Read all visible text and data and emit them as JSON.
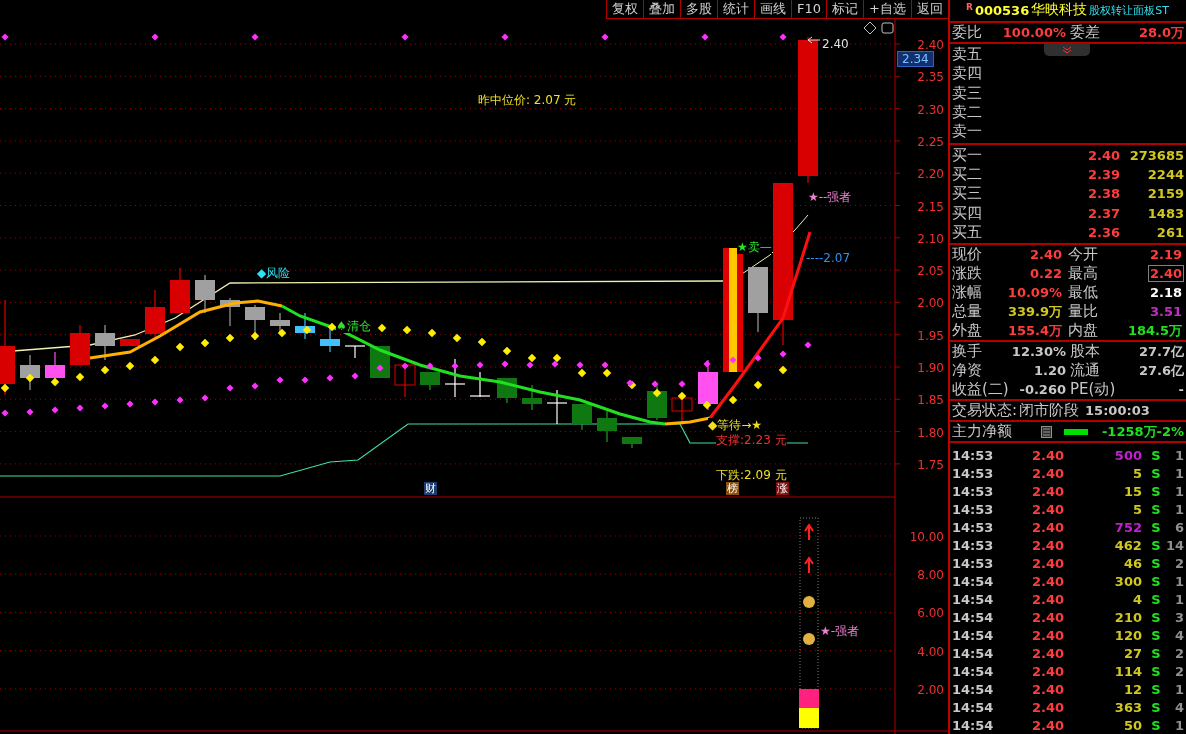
{
  "toolbar": [
    "复权",
    "叠加",
    "多股",
    "统计",
    "画线",
    "F10",
    "标记",
    "+自选",
    "返回"
  ],
  "chart": {
    "price_ticks": [
      "2.40",
      "2.35",
      "2.30",
      "2.25",
      "2.20",
      "2.15",
      "2.10",
      "2.05",
      "2.00",
      "1.95",
      "1.90",
      "1.85",
      "1.80",
      "1.75"
    ],
    "current_price_tag": "2.34",
    "labels": [
      {
        "text": "2.40",
        "color": "#e0e0e0"
      },
      {
        "text": "昨中位价: 2.07 元",
        "color": "#f0e020"
      },
      {
        "text": "★--强者",
        "color": "#f080d0"
      },
      {
        "text": "★卖—",
        "color": "#30e030"
      },
      {
        "text": "----2.07",
        "color": "#3090f0"
      },
      {
        "text": "◆风险",
        "color": "#30e0f0"
      },
      {
        "text": "♠清仓",
        "color": "#30e030"
      },
      {
        "text": "◆等待→★",
        "color": "#f0e020"
      },
      {
        "text": "支撑:2.23 元",
        "color": "#f03030"
      },
      {
        "text": "下跌:2.09 元",
        "color": "#f0e020"
      }
    ],
    "badges": [
      {
        "text": "财",
        "color": "#1c3c70"
      },
      {
        "text": "榜",
        "color": "#8a5010"
      },
      {
        "text": "涨",
        "color": "#801010"
      }
    ]
  },
  "indicator": {
    "ticks": [
      "10.00",
      "8.00",
      "6.00",
      "4.00",
      "2.00"
    ],
    "label": "★-强者"
  },
  "quote": {
    "badge": "R",
    "code": "000536",
    "name": "华映科技",
    "tag": "股权转让面板ST",
    "ratio": {
      "label": "委比",
      "value": "100.00%",
      "label2": "委差",
      "value2": "28.0万"
    },
    "sell": [
      {
        "label": "卖五"
      },
      {
        "label": "卖四"
      },
      {
        "label": "卖三"
      },
      {
        "label": "卖二"
      },
      {
        "label": "卖一"
      }
    ],
    "buy": [
      {
        "label": "买一",
        "price": "2.40",
        "volume": "273685"
      },
      {
        "label": "买二",
        "price": "2.39",
        "volume": "2244"
      },
      {
        "label": "买三",
        "price": "2.38",
        "volume": "2159"
      },
      {
        "label": "买四",
        "price": "2.37",
        "volume": "1483"
      },
      {
        "label": "买五",
        "price": "2.36",
        "volume": "261"
      }
    ],
    "stats": [
      {
        "label": "现价",
        "value": "2.40",
        "color": "#ff3c3c",
        "highlighted": false
      },
      {
        "label": "今开",
        "value": "2.19",
        "color": "#ff3c3c",
        "highlighted": false
      },
      {
        "label": "涨跌",
        "value": "0.22",
        "color": "#ff3c3c",
        "highlighted": false
      },
      {
        "label": "最高",
        "value": "2.40",
        "color": "#ff3c3c",
        "highlighted": true
      },
      {
        "label": "涨幅",
        "value": "10.09%",
        "color": "#ff3c3c",
        "highlighted": false
      },
      {
        "label": "最低",
        "value": "2.18",
        "color": "#ffffff",
        "highlighted": false
      },
      {
        "label": "总量",
        "value": "339.9万",
        "color": "#d0c820",
        "highlighted": false
      },
      {
        "label": "量比",
        "value": "3.51",
        "color": "#c030c0",
        "highlighted": false
      },
      {
        "label": "外盘",
        "value": "155.4万",
        "color": "#ff3c3c",
        "highlighted": false
      },
      {
        "label": "内盘",
        "value": "184.5万",
        "color": "#20e020",
        "highlighted": false
      }
    ],
    "fundamentals": [
      {
        "label": "换手",
        "value": "12.30%",
        "label2": "股本",
        "value2": "27.7亿"
      },
      {
        "label": "净资",
        "value": "1.20",
        "label2": "流通",
        "value2": "27.6亿"
      },
      {
        "label": "收益(二)",
        "value": "-0.260",
        "label2": "PE(动)",
        "value2": "-"
      }
    ],
    "status": {
      "label": "交易状态:",
      "value": "闭市阶段",
      "time": "15:00:03"
    },
    "main_flow": {
      "label": "主力净额",
      "value": "-1258万",
      "percent": "-2%"
    },
    "trades": [
      {
        "time": "14:53",
        "price": "2.40",
        "volume": "500",
        "color": "#c020d0",
        "side": "S",
        "count": "1"
      },
      {
        "time": "14:53",
        "price": "2.40",
        "volume": "5",
        "color": "#d0c820",
        "side": "S",
        "count": "1"
      },
      {
        "time": "14:53",
        "price": "2.40",
        "volume": "15",
        "color": "#d0c820",
        "side": "S",
        "count": "1"
      },
      {
        "time": "14:53",
        "price": "2.40",
        "volume": "5",
        "color": "#d0c820",
        "side": "S",
        "count": "1"
      },
      {
        "time": "14:53",
        "price": "2.40",
        "volume": "752",
        "color": "#c020d0",
        "side": "S",
        "count": "6"
      },
      {
        "time": "14:53",
        "price": "2.40",
        "volume": "462",
        "color": "#d0c820",
        "side": "S",
        "count": "14"
      },
      {
        "time": "14:53",
        "price": "2.40",
        "volume": "46",
        "color": "#d0c820",
        "side": "S",
        "count": "2"
      },
      {
        "time": "14:54",
        "price": "2.40",
        "volume": "300",
        "color": "#d0c820",
        "side": "S",
        "count": "1"
      },
      {
        "time": "14:54",
        "price": "2.40",
        "volume": "4",
        "color": "#d0c820",
        "side": "S",
        "count": "1"
      },
      {
        "time": "14:54",
        "price": "2.40",
        "volume": "210",
        "color": "#d0c820",
        "side": "S",
        "count": "3"
      },
      {
        "time": "14:54",
        "price": "2.40",
        "volume": "120",
        "color": "#d0c820",
        "side": "S",
        "count": "4"
      },
      {
        "time": "14:54",
        "price": "2.40",
        "volume": "27",
        "color": "#d0c820",
        "side": "S",
        "count": "2"
      },
      {
        "time": "14:54",
        "price": "2.40",
        "volume": "114",
        "color": "#d0c820",
        "side": "S",
        "count": "2"
      },
      {
        "time": "14:54",
        "price": "2.40",
        "volume": "12",
        "color": "#d0c820",
        "side": "S",
        "count": "1"
      },
      {
        "time": "14:54",
        "price": "2.40",
        "volume": "363",
        "color": "#d0c820",
        "side": "S",
        "count": "4"
      },
      {
        "time": "14:54",
        "price": "2.40",
        "volume": "50",
        "color": "#d0c820",
        "side": "S",
        "count": "1"
      }
    ]
  }
}
